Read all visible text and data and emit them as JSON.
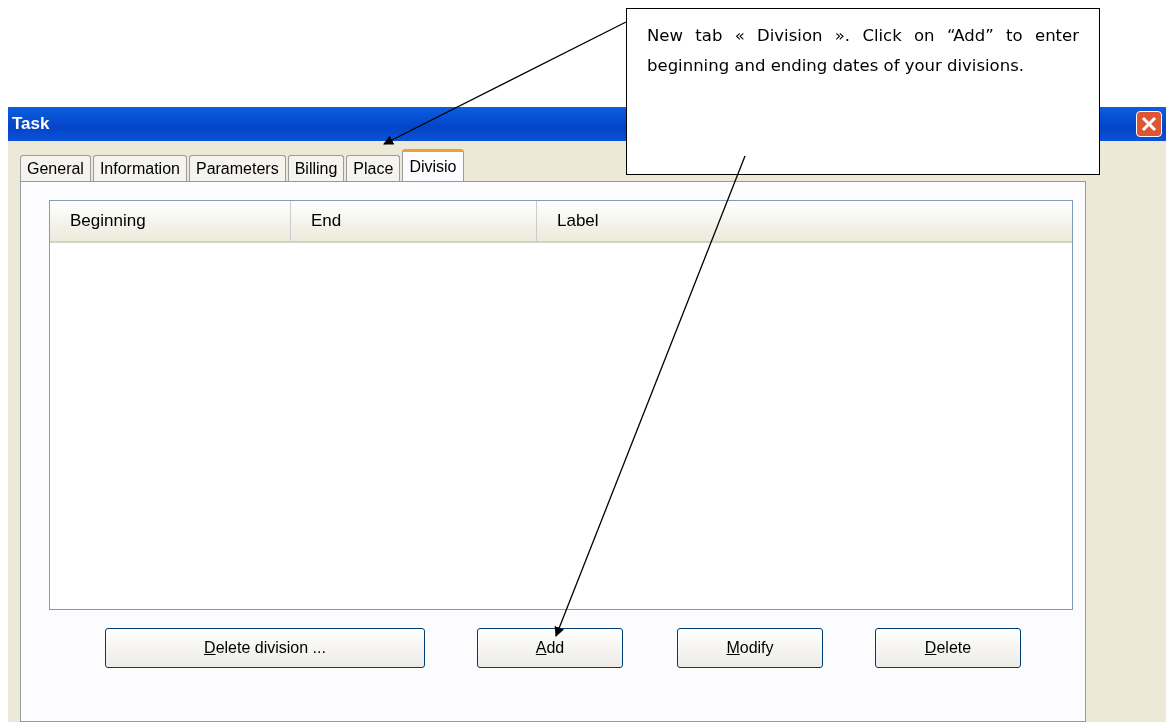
{
  "window": {
    "title": "Task"
  },
  "tabs": [
    {
      "label": "General",
      "selected": false
    },
    {
      "label": "Information",
      "selected": false
    },
    {
      "label": "Parameters",
      "selected": false
    },
    {
      "label": "Billing",
      "selected": false
    },
    {
      "label": "Place",
      "selected": false
    },
    {
      "label": "Divisio",
      "selected": true
    }
  ],
  "table": {
    "columns": [
      "Beginning",
      "End",
      "Label"
    ]
  },
  "buttons": [
    {
      "accel": "D",
      "rest": "elete division ..."
    },
    {
      "accel": "A",
      "rest": "dd"
    },
    {
      "accel": "M",
      "rest": "odify"
    },
    {
      "accel": "D",
      "rest": "elete"
    }
  ],
  "callout": {
    "text": "New tab « Division ». Click on “Add” to enter beginning and ending dates of your divisions."
  }
}
